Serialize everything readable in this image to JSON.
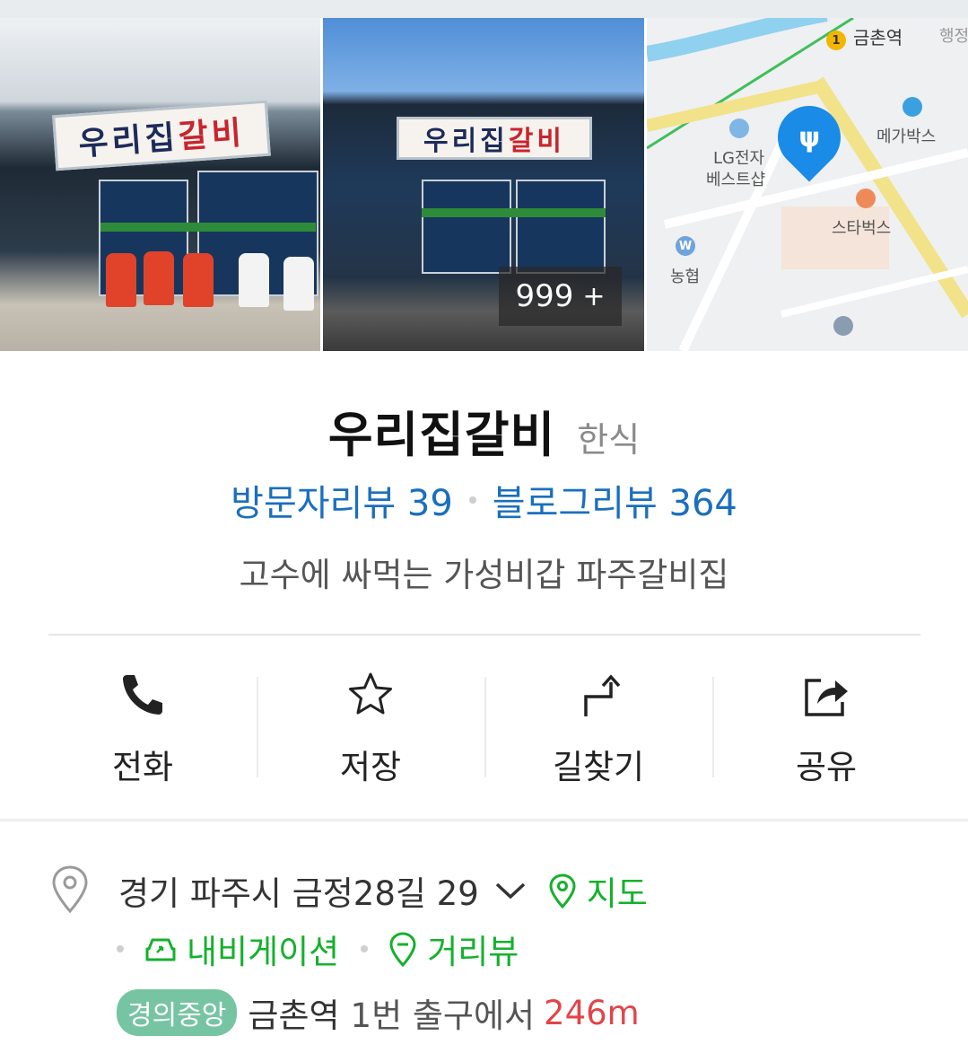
{
  "photos": {
    "count_number": "999",
    "count_suffix": "+",
    "sign_text_dark": "우리집",
    "sign_text_red": "갈비"
  },
  "map": {
    "labels": {
      "station": "금촌역",
      "station_num": "1",
      "admin": "행정",
      "megabox": "메가박스",
      "lg_line1": "LG전자",
      "lg_line2": "베스트샵",
      "starbucks": "스타벅스",
      "nonghyup": "농협",
      "nonghyup_logo": "W"
    }
  },
  "place": {
    "name": "우리집갈비",
    "category": "한식",
    "visitor_review": "방문자리뷰 39",
    "blog_review": "블로그리뷰 364",
    "description": "고수에 싸먹는 가성비갑 파주갈비집"
  },
  "actions": [
    {
      "label": "전화",
      "icon": "phone-icon"
    },
    {
      "label": "저장",
      "icon": "star-icon"
    },
    {
      "label": "길찾기",
      "icon": "directions-icon"
    },
    {
      "label": "공유",
      "icon": "share-icon"
    }
  ],
  "address": {
    "text": "경기 파주시 금정28길 29",
    "map_link": "지도",
    "navigation_link": "내비게이션",
    "streetview_link": "거리뷰"
  },
  "subway": {
    "line": "경의중앙",
    "station": "금촌역",
    "exit_text": "1번 출구에서",
    "distance": "246m"
  },
  "colors": {
    "review_blue": "#1a6fbd",
    "link_green": "#14b12c",
    "distance_red": "#e2444a",
    "line_badge": "#77c4a3",
    "map_pin": "#1a8be6"
  }
}
